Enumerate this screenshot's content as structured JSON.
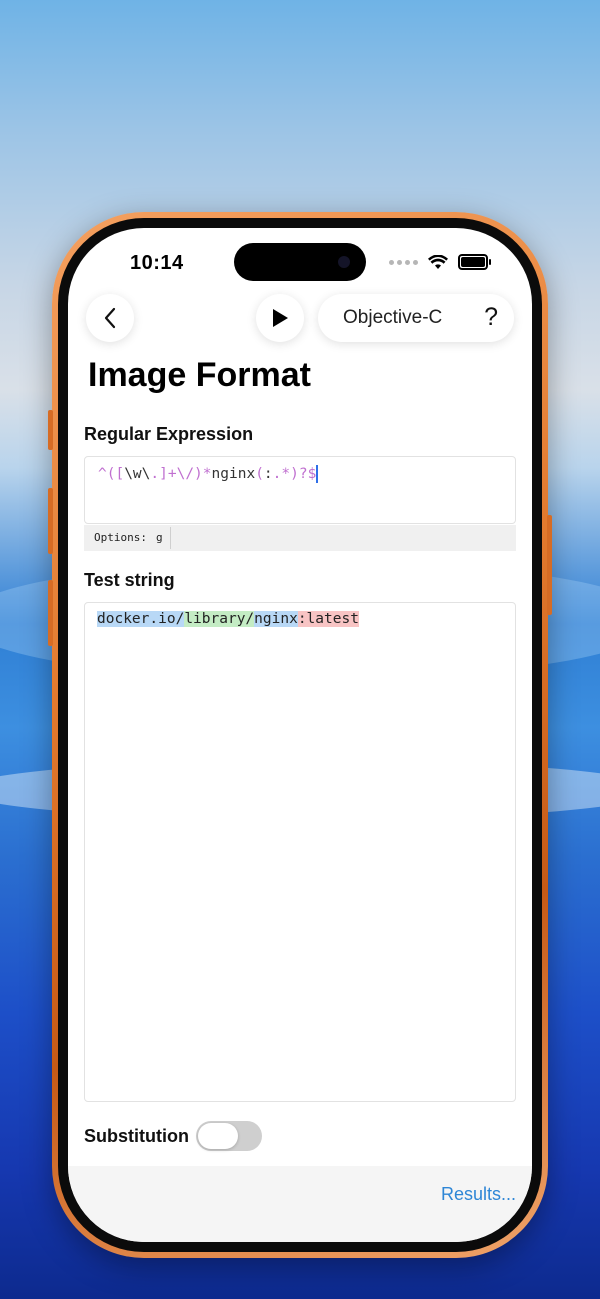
{
  "status_bar": {
    "time": "10:14"
  },
  "nav": {
    "language": "Objective-C",
    "help_label": "?"
  },
  "page": {
    "title": "Image Format"
  },
  "regex_section": {
    "label": "Regular Expression",
    "pattern_parts": [
      {
        "text": "^([",
        "kind": "meta"
      },
      {
        "text": "\\w\\",
        "kind": "lit"
      },
      {
        "text": ".",
        "kind": "meta"
      },
      {
        "text": "]+\\/)*",
        "kind": "meta"
      },
      {
        "text": "nginx",
        "kind": "lit"
      },
      {
        "text": "(",
        "kind": "meta"
      },
      {
        "text": ":",
        "kind": "lit"
      },
      {
        "text": ".*)?$",
        "kind": "meta"
      }
    ],
    "options_label": "Options:",
    "options_value": "g"
  },
  "test_section": {
    "label": "Test string",
    "segments": [
      {
        "text": "docker.io/",
        "highlight": "blue"
      },
      {
        "text": "library/",
        "highlight": "green"
      },
      {
        "text": "nginx",
        "highlight": "blue"
      },
      {
        "text": ":latest",
        "highlight": "red"
      }
    ]
  },
  "substitution": {
    "label": "Substitution",
    "enabled": false
  },
  "footer": {
    "results_label": "Results..."
  },
  "colors": {
    "accent": "#2e86d6",
    "regex_meta": "#c070d0",
    "highlight_blue": "#b8d8f6",
    "highlight_green": "#c4ecc4",
    "highlight_red": "#f8c4c4",
    "frame_orange": "#e27a2e"
  }
}
